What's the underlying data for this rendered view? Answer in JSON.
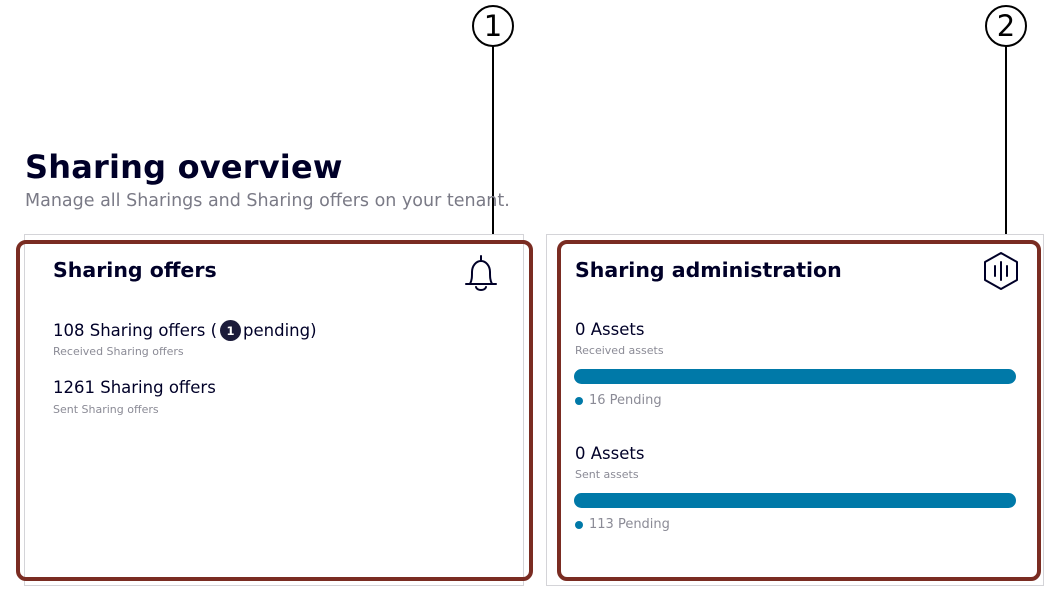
{
  "callouts": [
    "1",
    "2"
  ],
  "page": {
    "title": "Sharing overview",
    "subtitle": "Manage all Sharings and Sharing offers on your tenant."
  },
  "offers_card": {
    "title": "Sharing offers",
    "icon": "bell-icon",
    "received": {
      "count_text": "108 Sharing offers (",
      "badge": "1",
      "suffix": "pending)",
      "label": "Received Sharing offers"
    },
    "sent": {
      "count_text": "1261 Sharing offers",
      "label": "Sent Sharing offers"
    }
  },
  "admin_card": {
    "title": "Sharing administration",
    "icon": "hexagon-bars-icon",
    "received": {
      "count_text": "0 Assets",
      "label": "Received assets",
      "pending_text": "16 Pending",
      "assets_fraction": 0,
      "pending_fraction": 1
    },
    "sent": {
      "count_text": "0 Assets",
      "label": "Sent assets",
      "pending_text": "113 Pending",
      "assets_fraction": 0,
      "pending_fraction": 1
    }
  },
  "colors": {
    "accent": "#0079a8",
    "highlight": "#7a2c22",
    "title": "#000028",
    "badge": "#1b1b3a"
  }
}
